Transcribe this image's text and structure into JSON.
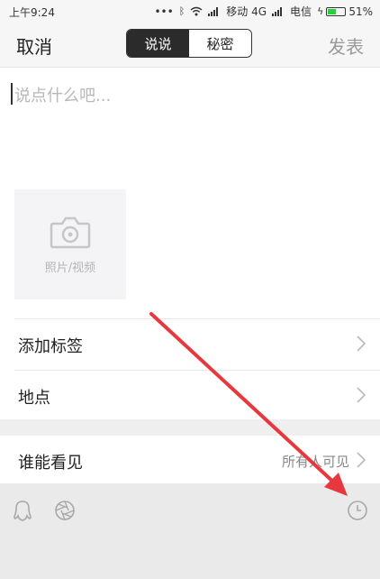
{
  "status_bar": {
    "time": "上午9:24",
    "carrier1": "移动 4G",
    "carrier2": "电信",
    "battery": "51%",
    "battery_level": 0.51
  },
  "header": {
    "cancel_label": "取消",
    "tabs": [
      {
        "label": "说说",
        "active": true
      },
      {
        "label": "秘密",
        "active": false
      }
    ],
    "publish_label": "发表"
  },
  "compose": {
    "placeholder": "说点什么吧..."
  },
  "media": {
    "label": "照片/视频"
  },
  "options": {
    "add_tag_label": "添加标签",
    "location_label": "地点",
    "visibility_label": "谁能看见",
    "visibility_value": "所有人可见"
  },
  "bottom_toolbar": {
    "icons": [
      "qq-penguin-icon",
      "aperture-icon",
      "clock-icon"
    ]
  },
  "annotation": {
    "color": "#e8383d"
  }
}
